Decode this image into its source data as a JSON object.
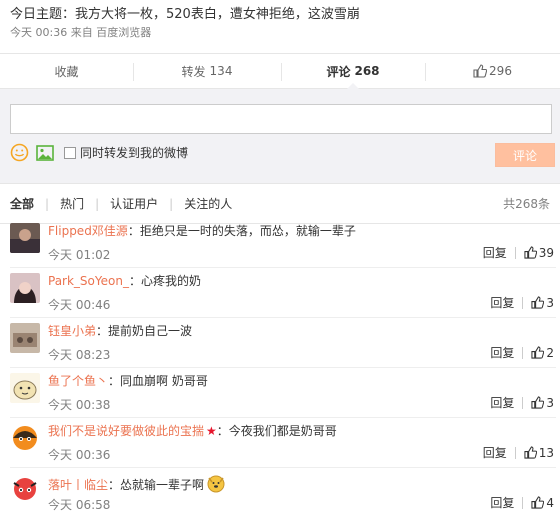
{
  "post": {
    "title": "今日主题：我方大将一枚，520表白，遭女神拒绝，这波雪崩",
    "time": "今天 00:36",
    "from": "来自",
    "source": "百度浏览器"
  },
  "actions": {
    "favorite": "收藏",
    "repost_label": "转发",
    "repost_count": "134",
    "comment_label": "评论",
    "comment_count": "268",
    "like_count": "296"
  },
  "comment_box": {
    "placeholder": "",
    "repost_option": "同时转发到我的微博",
    "submit": "评论"
  },
  "filters": {
    "items": [
      "全部",
      "热门",
      "认证用户",
      "关注的人"
    ],
    "total": "共268条"
  },
  "comments": [
    {
      "user": "Flipped邓佳源",
      "text": "：拒绝只是一时的失落，而怂，就输一辈子",
      "time": "今天 01:02",
      "reply": "回复",
      "likes": "39"
    },
    {
      "user": "Park_SoYeon_",
      "text": "：心疼我的奶",
      "time": "今天 00:46",
      "reply": "回复",
      "likes": "3"
    },
    {
      "user": "钰皇小弟",
      "text": "：提前奶自己一波",
      "time": "今天 08:23",
      "reply": "回复",
      "likes": "2"
    },
    {
      "user": "鱼了个鱼丶",
      "text": "：同血崩啊 奶哥哥",
      "time": "今天 00:38",
      "reply": "回复",
      "likes": "3"
    },
    {
      "user": "我们不是说好要做彼此的宝揣",
      "text": "：今夜我们都是奶哥哥",
      "time": "今天 00:36",
      "reply": "回复",
      "likes": "13"
    },
    {
      "user": "落叶丨临尘",
      "text": "：怂就输一辈子啊",
      "time": "今天 06:58",
      "reply": "回复",
      "likes": "4"
    }
  ],
  "colors": {
    "accent": "#eb7350",
    "submit_bg": "#ffc09f",
    "panel_bg": "#f2f2f5",
    "star": "#e6162d"
  }
}
